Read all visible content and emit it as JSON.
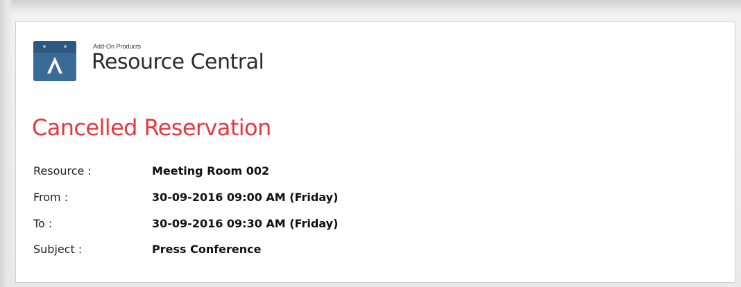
{
  "brand": {
    "subtitle": "Add-On Products",
    "title": "Resource Central"
  },
  "heading": "Cancelled Reservation",
  "details": [
    {
      "label": "Resource :",
      "value": "Meeting Room 002"
    },
    {
      "label": "From :",
      "value": "30-09-2016 09:00 AM (Friday)"
    },
    {
      "label": "To :",
      "value": "30-09-2016 09:30 AM (Friday)"
    },
    {
      "label": "Subject :",
      "value": "Press Conference"
    }
  ],
  "colors": {
    "heading": "#e8373f",
    "logo": "#3a6a98"
  },
  "icons": {
    "logo": "calendar-a-logo-icon"
  }
}
